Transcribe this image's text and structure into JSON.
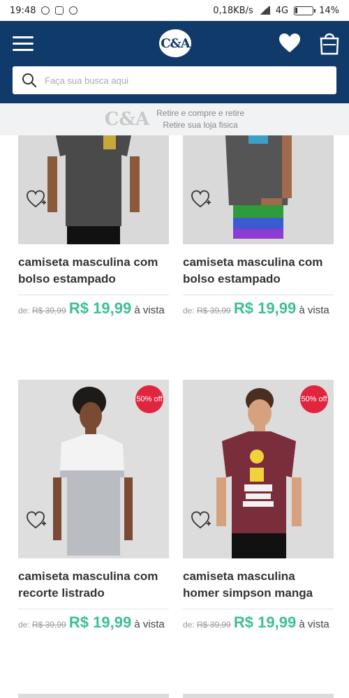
{
  "status_bar": {
    "time": "19:48",
    "speed": "0,18KB/s",
    "network": "4G",
    "battery": "14%",
    "battery_level": 0.14
  },
  "header": {
    "logo": "C&A",
    "wishlist_count": "",
    "cart_count": "",
    "search_placeholder": "Faça sua busca aqui"
  },
  "promo": {
    "logo": "C&A",
    "line1": "Retire e compre e retire",
    "line2": "Retire sua loja fisica",
    "logo_color": "#c9c9c9"
  },
  "colors": {
    "brand": "#0f3a69",
    "price": "#3dbf95",
    "badge_discount": "#e0263e",
    "badge_count": "#3cc3a0"
  },
  "products": [
    {
      "name": "camiseta masculina com bolso estampado",
      "old_price_prefix": "de:",
      "old_price": "R$ 39,99",
      "price": "R$ 19,99",
      "price_suffix": "à vista",
      "discount": "",
      "shirt_color": "#4a4a4a"
    },
    {
      "name": "camiseta masculina com bolso estampado",
      "old_price_prefix": "de:",
      "old_price": "R$ 39,99",
      "price": "R$ 19,99",
      "price_suffix": "à vista",
      "discount": "",
      "shirt_color": "#555555"
    },
    {
      "name": "camiseta masculina com recorte listrado",
      "old_price_prefix": "de:",
      "old_price": "R$ 39,99",
      "price": "R$ 19,99",
      "price_suffix": "à vista",
      "discount": "50% off",
      "shirt_color": "#ececec"
    },
    {
      "name": "camiseta masculina homer simpson manga",
      "old_price_prefix": "de:",
      "old_price": "R$ 39,99",
      "price": "R$ 19,99",
      "price_suffix": "à vista",
      "discount": "50% off",
      "shirt_color": "#7a2e3c"
    }
  ]
}
